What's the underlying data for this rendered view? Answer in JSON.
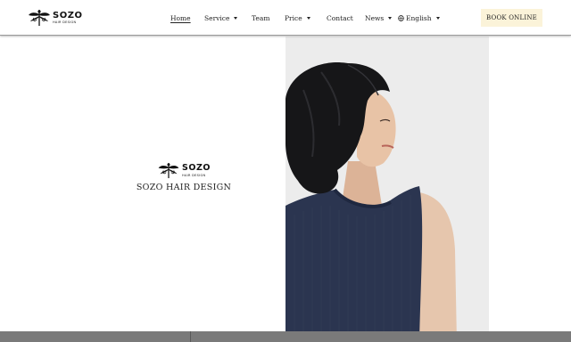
{
  "brand": {
    "logo_word": "SOZO",
    "logo_sub": "HAIR DESIGN",
    "name": "SOZO HAIR DESIGN"
  },
  "nav": {
    "home": "Home",
    "service": "Service",
    "team": "Team",
    "price": "Price",
    "contact": "Contact",
    "news": "News",
    "language": "English"
  },
  "cta": {
    "book": "BOOK ONLINE"
  },
  "colors": {
    "book_bg": "#fbf3d9",
    "footer_bar": "#7a7a7a",
    "photo_bg": "#ececec"
  },
  "icons": [
    "dragonfly-logo-icon",
    "globe-icon",
    "chevron-down-icon"
  ]
}
